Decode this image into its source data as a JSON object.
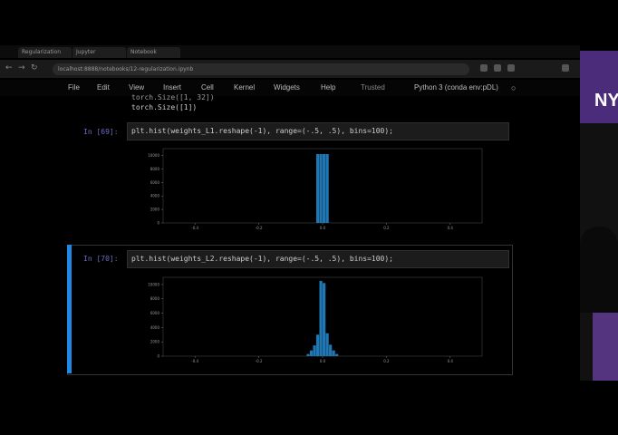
{
  "browser": {
    "tabs": [
      "Regularization",
      "Jupyter",
      "Notebook"
    ],
    "url": "localhost:8888/notebooks/12-regularization.ipynb"
  },
  "menu": {
    "items": [
      "File",
      "Edit",
      "View",
      "Insert",
      "Cell",
      "Kernel",
      "Widgets",
      "Help"
    ],
    "trusted": "Trusted",
    "kernel": "Python 3 (conda env:pDL)"
  },
  "output_top": {
    "line1": "torch.Size([1, 32])",
    "line2": "torch.Size([1])"
  },
  "cell69": {
    "prompt": "In [69]:",
    "code": "plt.hist(weights_L1.reshape(-1), range=(-.5, .5), bins=100);"
  },
  "cell70": {
    "prompt": "In [70]:",
    "code": "plt.hist(weights_L2.reshape(-1), range=(-.5, .5), bins=100);"
  },
  "colors": {
    "bar": "#1f77b4",
    "selected_cell": "#1e88e5",
    "brand": "#57068c"
  },
  "logo_text": "NY",
  "chart_data": [
    {
      "type": "bar",
      "title": "",
      "xlabel": "",
      "ylabel": "",
      "xlim": [
        -0.5,
        0.5
      ],
      "ylim": [
        0,
        11000
      ],
      "x_ticks": [
        "-0.4",
        "-0.2",
        "0.0",
        "0.2",
        "0.4"
      ],
      "y_ticks": [
        "0",
        "2000",
        "4000",
        "6000",
        "8000",
        "10000"
      ],
      "bins": [
        {
          "x": -0.02,
          "value": 10200
        },
        {
          "x": -0.01,
          "value": 10200
        },
        {
          "x": 0.0,
          "value": 10200
        },
        {
          "x": 0.01,
          "value": 10200
        }
      ]
    },
    {
      "type": "bar",
      "title": "",
      "xlabel": "",
      "ylabel": "",
      "xlim": [
        -0.5,
        0.5
      ],
      "ylim": [
        0,
        11000
      ],
      "x_ticks": [
        "-0.4",
        "-0.2",
        "0.0",
        "0.2",
        "0.4"
      ],
      "y_ticks": [
        "0",
        "2000",
        "4000",
        "6000",
        "8000",
        "10000"
      ],
      "bins": [
        {
          "x": -0.05,
          "value": 300
        },
        {
          "x": -0.04,
          "value": 800
        },
        {
          "x": -0.03,
          "value": 1500
        },
        {
          "x": -0.02,
          "value": 3000
        },
        {
          "x": -0.01,
          "value": 10500
        },
        {
          "x": 0.0,
          "value": 10200
        },
        {
          "x": 0.01,
          "value": 3200
        },
        {
          "x": 0.02,
          "value": 1600
        },
        {
          "x": 0.03,
          "value": 800
        },
        {
          "x": 0.04,
          "value": 300
        }
      ]
    }
  ]
}
